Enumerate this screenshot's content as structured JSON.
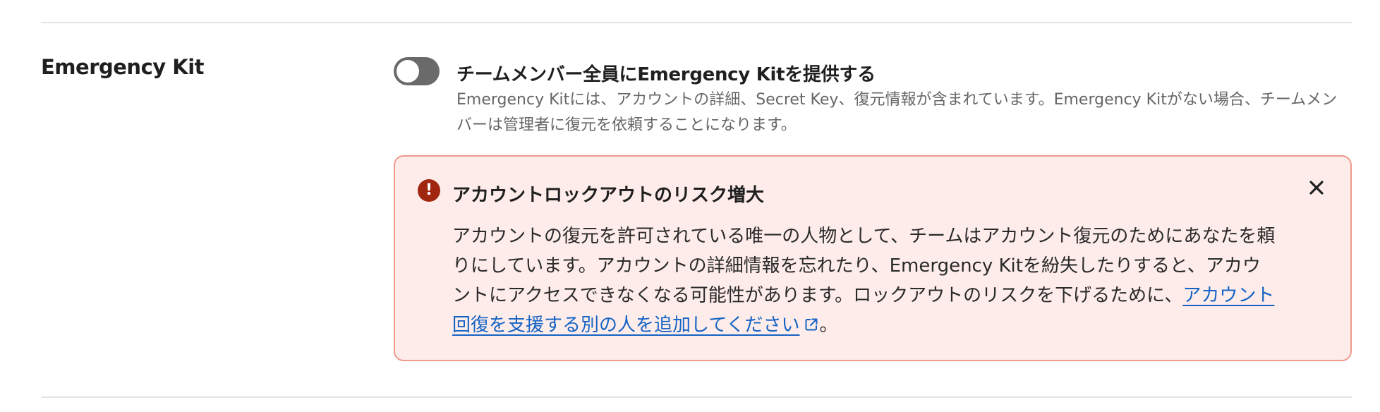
{
  "section": {
    "title": "Emergency Kit"
  },
  "setting": {
    "toggle_on": false,
    "label": "チームメンバー全員にEmergency Kitを提供する",
    "description": "Emergency Kitには、アカウントの詳細、Secret Key、復元情報が含まれています。Emergency Kitがない場合、チームメンバーは管理者に復元を依頼することになります。"
  },
  "alert": {
    "icon": "exclamation-circle-icon",
    "title": "アカウントロックアウトのリスク増大",
    "body_text": "アカウントの復元を許可されている唯一の人物として、チームはアカウント復元のためにあなたを頼りにしています。アカウントの詳細情報を忘れたり、Emergency Kitを紛失したりすると、アカウントにアクセスできなくなる可能性があります。ロックアウトのリスクを下げるために、",
    "link_text": "アカウント回復を支援する別の人を追加してください",
    "body_end": "。",
    "close_icon": "close-icon",
    "colors": {
      "background": "#fdecea",
      "border": "#ef9a8d",
      "icon": "#a1260f",
      "link": "#1463c4"
    }
  }
}
